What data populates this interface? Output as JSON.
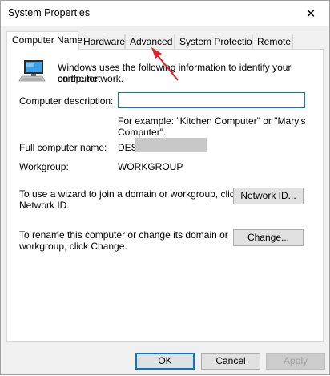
{
  "window": {
    "title": "System Properties",
    "close_glyph": "✕"
  },
  "tabs": [
    {
      "label": "Computer Name",
      "active": true
    },
    {
      "label": "Hardware",
      "active": false
    },
    {
      "label": "Advanced",
      "active": false
    },
    {
      "label": "System Protection",
      "active": false
    },
    {
      "label": "Remote",
      "active": false
    }
  ],
  "intro": {
    "icon": "computer-icon",
    "text_line1": "Windows uses the following information to identify your computer",
    "text_line2": "on the network."
  },
  "description": {
    "label": "Computer description:",
    "value": "",
    "hint_line1": "For example: \"Kitchen Computer\" or \"Mary's",
    "hint_line2": "Computer\"."
  },
  "full_name": {
    "label": "Full computer name:",
    "value": "DES"
  },
  "workgroup": {
    "label": "Workgroup:",
    "value": "WORKGROUP"
  },
  "network_id": {
    "text_line1": "To use a wizard to join a domain or workgroup, click",
    "text_line2": "Network ID.",
    "button_label": "Network ID..."
  },
  "change": {
    "text_line1": "To rename this computer or change its domain or",
    "text_line2": "workgroup, click Change.",
    "button_label": "Change..."
  },
  "footer": {
    "ok_label": "OK",
    "cancel_label": "Cancel",
    "apply_label": "Apply"
  },
  "colors": {
    "accent": "#0078d7",
    "annotation_arrow": "#e0222b"
  }
}
